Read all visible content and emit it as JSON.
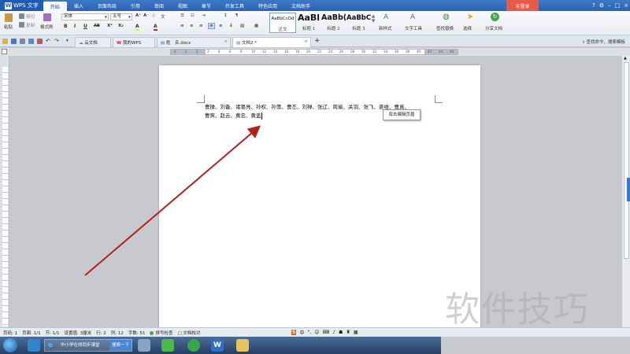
{
  "title_bar": {
    "app_name": "WPS 文字",
    "menu_tabs": [
      "开始",
      "插入",
      "页面布局",
      "引用",
      "审阅",
      "视图",
      "章节",
      "开发工具",
      "特色应用",
      "文档助手"
    ],
    "login_label": "未登录",
    "window_controls": [
      "?",
      "⚙",
      "–",
      "□",
      "×"
    ]
  },
  "ribbon": {
    "paste": "粘贴",
    "cut": "剪切",
    "copy": "复制",
    "format_painter": "格式刷",
    "font_name": "宋体",
    "font_size": "五号",
    "format_buttons": [
      "B",
      "I",
      "U",
      "AB",
      "X²",
      "X₂",
      "A",
      "A"
    ],
    "styles": [
      {
        "preview": "AaBbCcDd",
        "label": "正文"
      },
      {
        "preview": "AaBl",
        "label": "标题 1"
      },
      {
        "preview": "AaBb(",
        "label": "标题 2"
      },
      {
        "preview": "AaBbC",
        "label": "标题 3"
      }
    ],
    "new_style": "新样式",
    "text_tools": "文字工具",
    "find_replace": "查找替换",
    "select": "选择",
    "share_doc": "分享文档"
  },
  "tabs": {
    "items": [
      {
        "label": "云文档",
        "active": false
      },
      {
        "label": "我的WPS",
        "active": false
      },
      {
        "label": "姓　名.docx",
        "active": false
      },
      {
        "label": "文档2 *",
        "active": true
      }
    ],
    "new_tab": "+",
    "search_cmd": "查找命令、搜索模板"
  },
  "ruler": {
    "ticks": [
      "6",
      "4",
      "2",
      "2",
      "4",
      "6",
      "8",
      "10",
      "12",
      "14",
      "16",
      "18",
      "20",
      "22",
      "24",
      "26",
      "28",
      "30",
      "32",
      "34",
      "36",
      "38",
      "40",
      "42",
      "44",
      "46"
    ]
  },
  "document": {
    "line1": "曹操、刘备、诸葛亮、孙权、孙策、曹丕、刘禅、张辽、周瑜、关羽、张飞、姜维、曹真、",
    "line2": "曹爽、赵云、黄忠、黄盖",
    "tooltip": "双击编辑页眉"
  },
  "status_bar": {
    "page_num": "页码: 1",
    "pages": "页面: 1/1",
    "section": "节: 1/1",
    "setting": "设置值: 3厘米",
    "row": "行: 2",
    "col": "列: 12",
    "chars": "字数: 51",
    "spell": "拼写检查",
    "proof": "文档校对"
  },
  "ime": {
    "label": "中"
  },
  "taskbar": {
    "browser_title": "中小学在线同步课堂",
    "search_button": "搜索一下"
  },
  "watermark": "软件技巧",
  "colors": {
    "title_bar": "#2a63b3",
    "login": "#e8594a",
    "arrow": "#b3201d",
    "cursor": "#000000"
  }
}
